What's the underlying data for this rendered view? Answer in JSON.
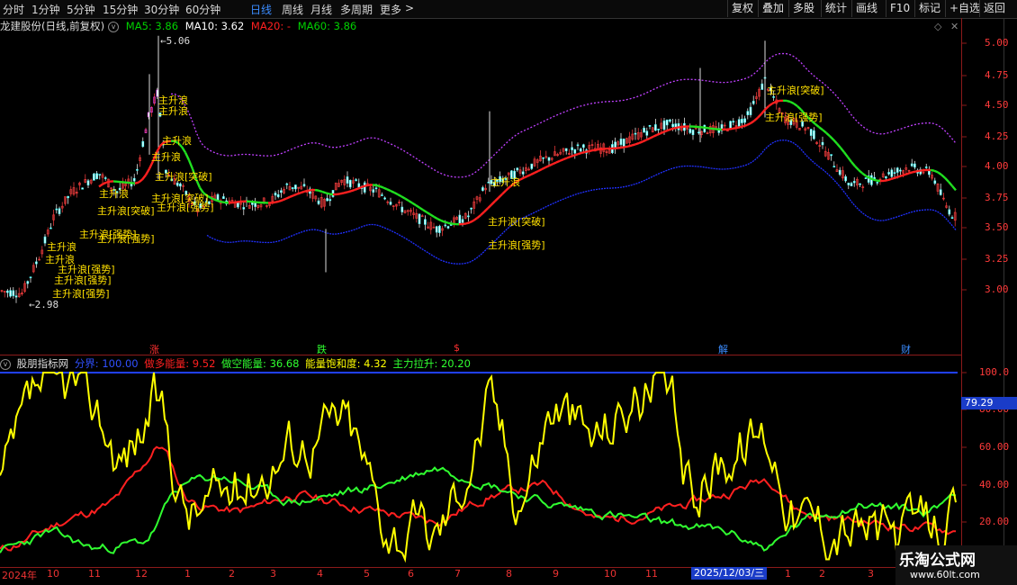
{
  "toolbar": {
    "periods": [
      "分时",
      "1分钟",
      "5分钟",
      "15分钟",
      "30分钟",
      "60分钟",
      "日线",
      "周线",
      "月线",
      "多周期",
      "更多"
    ],
    "active_period": "日线",
    "more_arrow": ">",
    "buttons": [
      "复权",
      "叠加",
      "多股",
      "统计",
      "画线",
      "F10",
      "标记",
      "+自选",
      "返回"
    ]
  },
  "main_info": {
    "title": "龙建股份(日线,前复权)",
    "ma5": "MA5: 3.86",
    "ma10": "MA10: 3.62",
    "ma20": "MA20: -",
    "ma60": "MA60: 3.86",
    "colors": {
      "ma5": "#00d200",
      "ma10": "#ffffff",
      "ma20": "#ff2020",
      "ma60": "#00d200"
    }
  },
  "price_axis": [
    "5.00",
    "4.75",
    "4.50",
    "4.25",
    "4.00",
    "3.75",
    "3.50",
    "3.25",
    "3.00"
  ],
  "high_label": "5.06",
  "low_label": "2.98",
  "annotations": [
    "主升浪",
    "主升浪",
    "主升浪",
    "主升浪",
    "主升浪[突破]",
    "主升浪",
    "主升浪[突破]",
    "主升浪[强势]",
    "主升浪[强势]",
    "主升浪",
    "主升浪",
    "主升浪[强势]",
    "主升浪[强势]",
    "主升浪[强势]",
    "主升浪[突破]",
    "主升浪[强势]",
    "主升浪",
    "主升浪[突破]",
    "主升浪[强势]",
    "主升浪[突破]",
    "主升浪[强势]"
  ],
  "markers": [
    {
      "text": "涨",
      "color": "#ff3030"
    },
    {
      "text": "跌",
      "color": "#30ff30"
    },
    {
      "text": "$",
      "color": "#ff3030"
    },
    {
      "text": "解",
      "color": "#3b8cff"
    },
    {
      "text": "财",
      "color": "#3b8cff"
    }
  ],
  "indicator": {
    "title": "股朋指标网",
    "fenjie": "分界: 100.00",
    "zuoduo": "做多能量: 9.52",
    "zuokong": "做空能量: 36.68",
    "baohe": "能量饱和度: 4.32",
    "lasheng": "主力拉升: 20.20",
    "axis": [
      "100.0",
      "80.00",
      "60.00",
      "40.00",
      "20.00"
    ],
    "current_value": "79.29"
  },
  "time_axis": {
    "months": [
      "2024年",
      "10",
      "11",
      "12",
      "1",
      "2",
      "3",
      "4",
      "5",
      "6",
      "7",
      "8",
      "9",
      "10",
      "11",
      "12",
      "1",
      "2",
      "3",
      "4"
    ],
    "crosshair_date": "2025/12/03/三"
  },
  "watermark": {
    "line1": "乐淘公式网",
    "line2": "www.60lt.com"
  }
}
